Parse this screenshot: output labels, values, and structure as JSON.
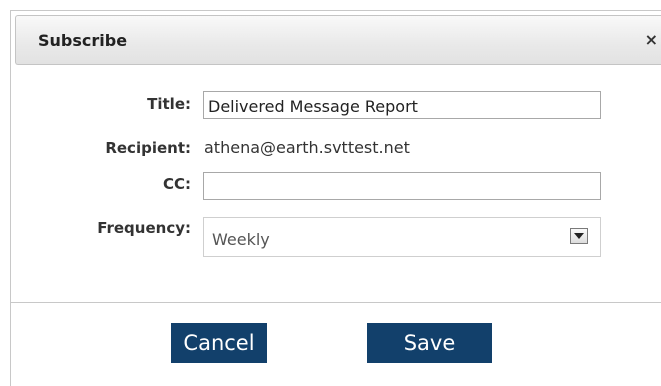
{
  "dialog": {
    "title": "Subscribe",
    "close_glyph": "×"
  },
  "form": {
    "title_label": "Title:",
    "title_value": "Delivered Message Report",
    "recipient_label": "Recipient:",
    "recipient_value": "athena@earth.svttest.net",
    "cc_label": "CC:",
    "cc_value": "",
    "frequency_label": "Frequency:",
    "frequency_value": "Weekly",
    "frequency_icon": "dropdown-arrow-icon"
  },
  "buttons": {
    "cancel_label": "Cancel",
    "save_label": "Save"
  },
  "colors": {
    "button_bg": "#12406b",
    "button_text": "#ffffff"
  }
}
